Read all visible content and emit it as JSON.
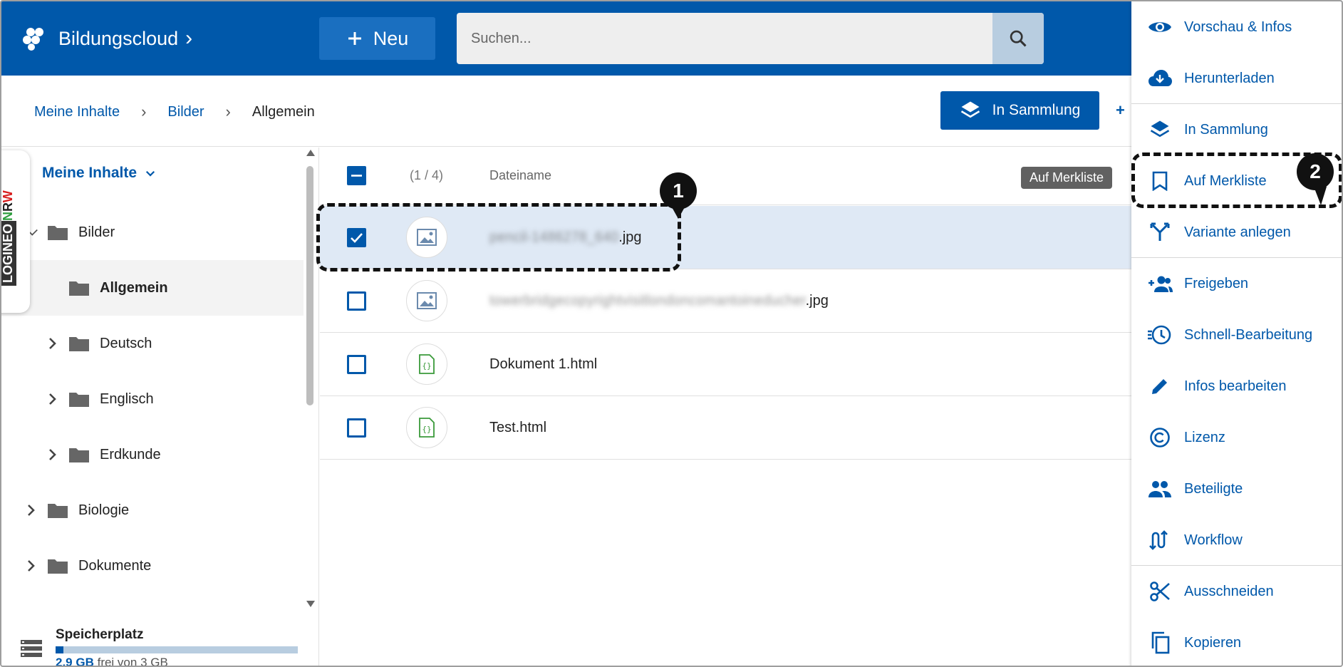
{
  "header": {
    "brand": "Bildungscloud",
    "new_button": "Neu",
    "search_placeholder": "Suchen..."
  },
  "breadcrumb": {
    "items": [
      "Meine Inhalte",
      "Bilder",
      "Allgemein"
    ]
  },
  "toolbar": {
    "collection_button": "In Sammlung",
    "share_partial": "+"
  },
  "sidebar": {
    "title": "Meine Inhalte",
    "items": [
      {
        "label": "Bilder"
      },
      {
        "label": "Allgemein"
      },
      {
        "label": "Deutsch"
      },
      {
        "label": "Englisch"
      },
      {
        "label": "Erdkunde"
      },
      {
        "label": "Biologie"
      },
      {
        "label": "Dokumente"
      }
    ],
    "badge": {
      "part1": "LOGINEO",
      "part2_n": "N",
      "part2_r": "R",
      "part2_w": "W"
    },
    "storage": {
      "title": "Speicherplatz",
      "free_value": "2,9 GB",
      "free_suffix": "frei von 3 GB",
      "used_fraction": 0.033
    }
  },
  "list": {
    "count": "(1 / 4)",
    "column": "Dateiname",
    "tooltip": "Auf Merkliste",
    "rows": [
      {
        "name_blurred": "pencil-1486278_640",
        "ext": ".jpg",
        "selected": true
      },
      {
        "name_blurred": "towerbridgecopyrightvisitlondoncomantoineducher",
        "ext": ".jpg",
        "selected": false
      },
      {
        "name": "Dokument 1.html",
        "selected": false
      },
      {
        "name": "Test.html",
        "selected": false
      }
    ]
  },
  "menu": {
    "items": [
      {
        "label": "Vorschau & Infos",
        "icon": "eye-icon"
      },
      {
        "label": "Herunterladen",
        "icon": "cloud-download-icon"
      },
      {
        "label": "In Sammlung",
        "icon": "layers-icon"
      },
      {
        "label": "Auf Merkliste",
        "icon": "bookmark-icon"
      },
      {
        "label": "Variante anlegen",
        "icon": "fork-icon"
      },
      {
        "label": "Freigeben",
        "icon": "person-add-icon"
      },
      {
        "label": "Schnell-Bearbeitung",
        "icon": "history-fast-icon"
      },
      {
        "label": "Infos bearbeiten",
        "icon": "pencil-icon"
      },
      {
        "label": "Lizenz",
        "icon": "copyright-icon"
      },
      {
        "label": "Beteiligte",
        "icon": "people-icon"
      },
      {
        "label": "Workflow",
        "icon": "workflow-icon"
      },
      {
        "label": "Ausschneiden",
        "icon": "scissors-icon"
      },
      {
        "label": "Kopieren",
        "icon": "copy-icon"
      }
    ]
  },
  "annotations": {
    "marker1": "1",
    "marker2": "2"
  },
  "colors": {
    "primary": "#0058aa",
    "selected_row": "#dfe9f5"
  }
}
